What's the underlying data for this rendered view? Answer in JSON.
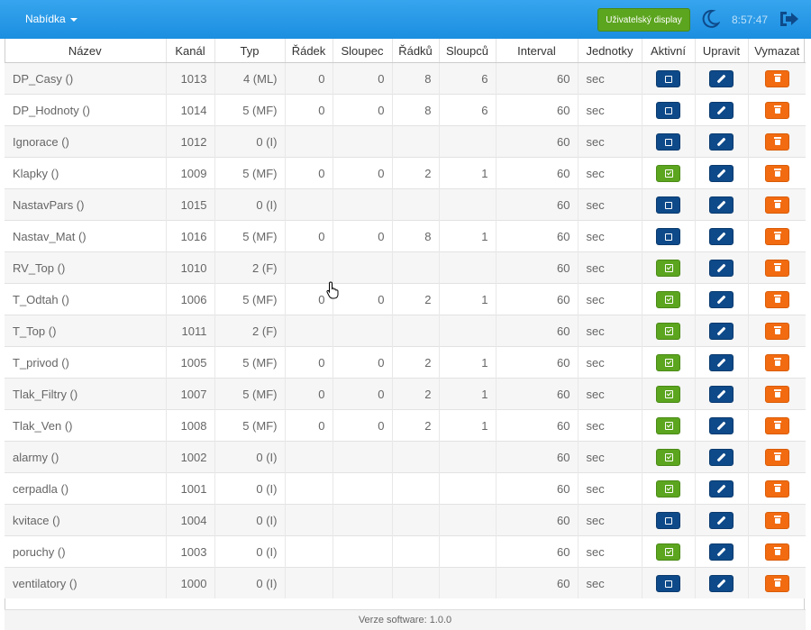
{
  "header": {
    "menu_label": "Nabídka",
    "display_button": "Uživatelský display",
    "clock": "8:57:47",
    "icons": {
      "theme": "moon-icon",
      "logout": "logout-icon"
    },
    "colors": {
      "bar": "#1b8ee0",
      "green": "#5ca51f",
      "dark": "#0e4a8a",
      "orange": "#f26b10"
    }
  },
  "table": {
    "columns": [
      "Název",
      "Kanál",
      "Typ",
      "Řádek",
      "Sloupec",
      "Řádků",
      "Sloupců",
      "Interval",
      "Jednotky",
      "Aktivní",
      "Upravit",
      "Vymazat"
    ],
    "rows": [
      {
        "name": "DP_Casy ()",
        "channel": "1013",
        "type": "4 (ML)",
        "row": "0",
        "col": "0",
        "rows": "8",
        "cols": "6",
        "interval": "60",
        "unit": "sec",
        "active": false
      },
      {
        "name": "DP_Hodnoty ()",
        "channel": "1014",
        "type": "5 (MF)",
        "row": "0",
        "col": "0",
        "rows": "8",
        "cols": "6",
        "interval": "60",
        "unit": "sec",
        "active": false
      },
      {
        "name": "Ignorace ()",
        "channel": "1012",
        "type": "0 (I)",
        "row": "",
        "col": "",
        "rows": "",
        "cols": "",
        "interval": "60",
        "unit": "sec",
        "active": false
      },
      {
        "name": "Klapky ()",
        "channel": "1009",
        "type": "5 (MF)",
        "row": "0",
        "col": "0",
        "rows": "2",
        "cols": "1",
        "interval": "60",
        "unit": "sec",
        "active": true
      },
      {
        "name": "NastavPars ()",
        "channel": "1015",
        "type": "0 (I)",
        "row": "",
        "col": "",
        "rows": "",
        "cols": "",
        "interval": "60",
        "unit": "sec",
        "active": false
      },
      {
        "name": "Nastav_Mat ()",
        "channel": "1016",
        "type": "5 (MF)",
        "row": "0",
        "col": "0",
        "rows": "8",
        "cols": "1",
        "interval": "60",
        "unit": "sec",
        "active": false
      },
      {
        "name": "RV_Top ()",
        "channel": "1010",
        "type": "2 (F)",
        "row": "",
        "col": "",
        "rows": "",
        "cols": "",
        "interval": "60",
        "unit": "sec",
        "active": true
      },
      {
        "name": "T_Odtah ()",
        "channel": "1006",
        "type": "5 (MF)",
        "row": "0",
        "col": "0",
        "rows": "2",
        "cols": "1",
        "interval": "60",
        "unit": "sec",
        "active": true
      },
      {
        "name": "T_Top ()",
        "channel": "1011",
        "type": "2 (F)",
        "row": "",
        "col": "",
        "rows": "",
        "cols": "",
        "interval": "60",
        "unit": "sec",
        "active": true
      },
      {
        "name": "T_privod ()",
        "channel": "1005",
        "type": "5 (MF)",
        "row": "0",
        "col": "0",
        "rows": "2",
        "cols": "1",
        "interval": "60",
        "unit": "sec",
        "active": true
      },
      {
        "name": "Tlak_Filtry ()",
        "channel": "1007",
        "type": "5 (MF)",
        "row": "0",
        "col": "0",
        "rows": "2",
        "cols": "1",
        "interval": "60",
        "unit": "sec",
        "active": true
      },
      {
        "name": "Tlak_Ven ()",
        "channel": "1008",
        "type": "5 (MF)",
        "row": "0",
        "col": "0",
        "rows": "2",
        "cols": "1",
        "interval": "60",
        "unit": "sec",
        "active": true
      },
      {
        "name": "alarmy ()",
        "channel": "1002",
        "type": "0 (I)",
        "row": "",
        "col": "",
        "rows": "",
        "cols": "",
        "interval": "60",
        "unit": "sec",
        "active": true
      },
      {
        "name": "cerpadla ()",
        "channel": "1001",
        "type": "0 (I)",
        "row": "",
        "col": "",
        "rows": "",
        "cols": "",
        "interval": "60",
        "unit": "sec",
        "active": true
      },
      {
        "name": "kvitace ()",
        "channel": "1004",
        "type": "0 (I)",
        "row": "",
        "col": "",
        "rows": "",
        "cols": "",
        "interval": "60",
        "unit": "sec",
        "active": false
      },
      {
        "name": "poruchy ()",
        "channel": "1003",
        "type": "0 (I)",
        "row": "",
        "col": "",
        "rows": "",
        "cols": "",
        "interval": "60",
        "unit": "sec",
        "active": true
      },
      {
        "name": "ventilatory ()",
        "channel": "1000",
        "type": "0 (I)",
        "row": "",
        "col": "",
        "rows": "",
        "cols": "",
        "interval": "60",
        "unit": "sec",
        "active": false
      }
    ]
  },
  "footer": {
    "version": "Verze software: 1.0.0"
  }
}
